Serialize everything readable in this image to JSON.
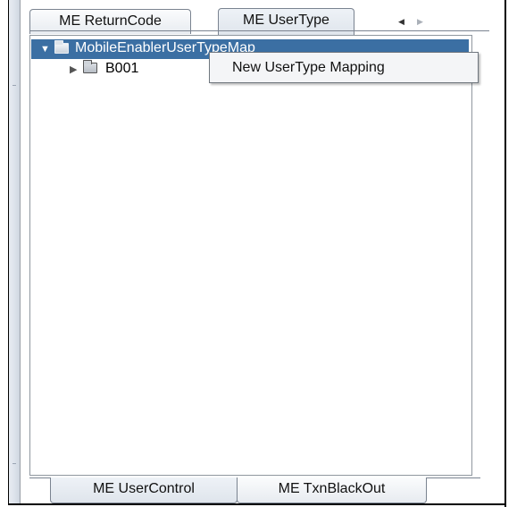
{
  "top_tabs": {
    "tab1_label": "ME ReturnCode",
    "tab2_label": "ME UserType",
    "active": "ME UserType",
    "scroll_left_icon": "triangle-left",
    "scroll_right_icon": "triangle-right"
  },
  "tree": {
    "root": {
      "label": "MobileEnablerUserTypeMap",
      "expanded": true,
      "selected": true,
      "icon": "folder-icon"
    },
    "children": [
      {
        "label": "B001",
        "expanded": false,
        "icon": "folder-icon"
      }
    ]
  },
  "context_menu": {
    "items": [
      {
        "label": "New  UserType Mapping"
      }
    ]
  },
  "bottom_tabs": {
    "tab1_label": "ME UserControl",
    "tab2_label": "ME TxnBlackOut",
    "active": "ME UserControl"
  },
  "colors": {
    "selection": "#3b6fa3",
    "menu_background": "#f4f5f7",
    "tab_border": "#7a8390"
  }
}
